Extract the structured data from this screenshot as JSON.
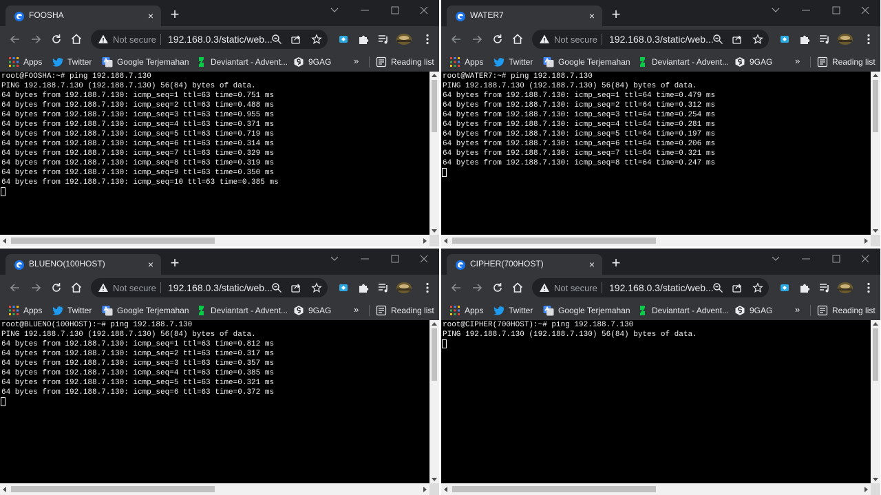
{
  "shared": {
    "tab_close_glyph": "×",
    "new_tab_glyph": "+",
    "security_label": "Not secure",
    "url_display": "192.168.0.3/static/web...",
    "bookmarks": {
      "apps": "Apps",
      "twitter": "Twitter",
      "google_translate": "Google Terjemahan",
      "deviantart": "Deviantart - Advent...",
      "ninegag": "9GAG",
      "overflow": "»",
      "reading_list": "Reading list"
    }
  },
  "colors": {
    "titlebar_bg": "#202124",
    "toolbar_bg": "#35363a",
    "terminal_bg": "#000000",
    "terminal_fg": "#f0f0f0",
    "twitter_blue": "#1d9bf0",
    "extension_accent": "#2da9e1"
  },
  "windows": [
    {
      "tab_title": "FOOSHA",
      "terminal_lines": [
        "root@FOOSHA:~# ping 192.188.7.130",
        "PING 192.188.7.130 (192.188.7.130) 56(84) bytes of data.",
        "64 bytes from 192.188.7.130: icmp_seq=1 ttl=63 time=0.751 ms",
        "64 bytes from 192.188.7.130: icmp_seq=2 ttl=63 time=0.488 ms",
        "64 bytes from 192.188.7.130: icmp_seq=3 ttl=63 time=0.955 ms",
        "64 bytes from 192.188.7.130: icmp_seq=4 ttl=63 time=0.371 ms",
        "64 bytes from 192.188.7.130: icmp_seq=5 ttl=63 time=0.719 ms",
        "64 bytes from 192.188.7.130: icmp_seq=6 ttl=63 time=0.314 ms",
        "64 bytes from 192.188.7.130: icmp_seq=7 ttl=63 time=0.329 ms",
        "64 bytes from 192.188.7.130: icmp_seq=8 ttl=63 time=0.319 ms",
        "64 bytes from 192.188.7.130: icmp_seq=9 ttl=63 time=0.350 ms",
        "64 bytes from 192.188.7.130: icmp_seq=10 ttl=63 time=0.385 ms"
      ]
    },
    {
      "tab_title": "WATER7",
      "terminal_lines": [
        "root@WATER7:~# ping 192.188.7.130",
        "PING 192.188.7.130 (192.188.7.130) 56(84) bytes of data.",
        "64 bytes from 192.188.7.130: icmp_seq=1 ttl=64 time=0.479 ms",
        "64 bytes from 192.188.7.130: icmp_seq=2 ttl=64 time=0.312 ms",
        "64 bytes from 192.188.7.130: icmp_seq=3 ttl=64 time=0.254 ms",
        "64 bytes from 192.188.7.130: icmp_seq=4 ttl=64 time=0.281 ms",
        "64 bytes from 192.188.7.130: icmp_seq=5 ttl=64 time=0.197 ms",
        "64 bytes from 192.188.7.130: icmp_seq=6 ttl=64 time=0.206 ms",
        "64 bytes from 192.188.7.130: icmp_seq=7 ttl=64 time=0.321 ms",
        "64 bytes from 192.188.7.130: icmp_seq=8 ttl=64 time=0.247 ms"
      ]
    },
    {
      "tab_title": "BLUENO(100HOST)",
      "terminal_lines": [
        "root@BLUENO(100HOST):~# ping 192.188.7.130",
        "PING 192.188.7.130 (192.188.7.130) 56(84) bytes of data.",
        "64 bytes from 192.188.7.130: icmp_seq=1 ttl=63 time=0.812 ms",
        "64 bytes from 192.188.7.130: icmp_seq=2 ttl=63 time=0.317 ms",
        "64 bytes from 192.188.7.130: icmp_seq=3 ttl=63 time=0.357 ms",
        "64 bytes from 192.188.7.130: icmp_seq=4 ttl=63 time=0.385 ms",
        "64 bytes from 192.188.7.130: icmp_seq=5 ttl=63 time=0.321 ms",
        "64 bytes from 192.188.7.130: icmp_seq=6 ttl=63 time=0.372 ms"
      ]
    },
    {
      "tab_title": "CIPHER(700HOST)",
      "terminal_lines": [
        "root@CIPHER(700HOST):~# ping 192.188.7.130",
        "PING 192.188.7.130 (192.188.7.130) 56(84) bytes of data."
      ]
    }
  ]
}
